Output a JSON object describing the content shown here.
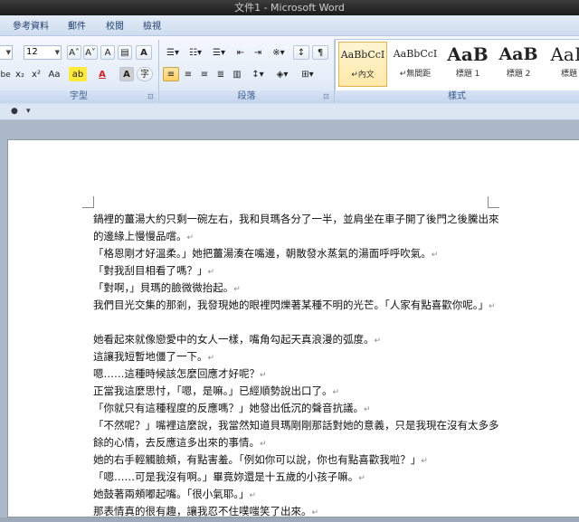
{
  "window": {
    "title": "文件1 - Microsoft Word"
  },
  "ribbon_tabs": [
    "參考資料",
    "郵件",
    "校閱",
    "檢視"
  ],
  "font": {
    "size_value": "12",
    "grow_label": "A˄",
    "shrink_label": "A˅",
    "clear_label": "A",
    "border_char_label": "A",
    "strike_label": "abe",
    "sub_label": "x₂",
    "sup_label": "x²",
    "case_label": "Aa",
    "highlight_label": "ab",
    "color_label": "A",
    "shade_label": "A",
    "enclose_label": "字",
    "group_label": "字型"
  },
  "paragraph": {
    "group_label": "段落"
  },
  "styles": {
    "group_label": "樣式",
    "items": [
      {
        "sample": "AaBbCcI",
        "name": "↵內文"
      },
      {
        "sample": "AaBbCcI",
        "name": "↵無間距"
      },
      {
        "sample": "AaB",
        "name": "標題 1"
      },
      {
        "sample": "AaB",
        "name": "標題 2"
      },
      {
        "sample": "AaB",
        "name": "標題"
      }
    ]
  },
  "qat": {
    "bullet": "●",
    "arrow": "▾"
  },
  "document": {
    "lines": [
      "鍋裡的薑湯大約只剩一碗左右，我和貝瑪各分了一半，並肩坐在車子開了後門之後騰出來的邊緣上慢慢品嚐。",
      "「格恩剛才好溫柔。」她把薑湯湊在嘴邊，朝散發水蒸氣的湯面呼呼吹氣。",
      "「對我刮目相看了嗎？」",
      "「對啊，」貝瑪的臉微微抬起。",
      "我們目光交集的那剎，我發現她的眼裡閃爍著某種不明的光芒。「人家有點喜歡你呢。」",
      "她看起來就像戀愛中的女人一樣，嘴角勾起天真浪漫的弧度。",
      "這讓我短暫地僵了一下。",
      "嗯……這種時候該怎麼回應才好呢？",
      "正當我這麼思忖，「嗯，是嘛。」已經順勢說出口了。",
      "「你就只有這種程度的反應嗎？」她發出低沉的聲音抗議。",
      "「不然呢？」嘴裡這麼說，我當然知道貝瑪剛剛那話對她的意義，只是我現在沒有太多多餘的心情，去反應這多出來的事情。",
      "她的右手輕觸臉頰，有點害羞。「例如你可以說，你也有點喜歡我啦？」",
      "「嗯……可是我沒有啊。」畢竟妳還是十五歲的小孩子嘛。",
      "她鼓著兩頰嘟起嘴。「很小氣耶。」",
      "那表情真的很有趣，讓我忍不住噗嗤笑了出來。"
    ],
    "para_mark": "↵"
  }
}
